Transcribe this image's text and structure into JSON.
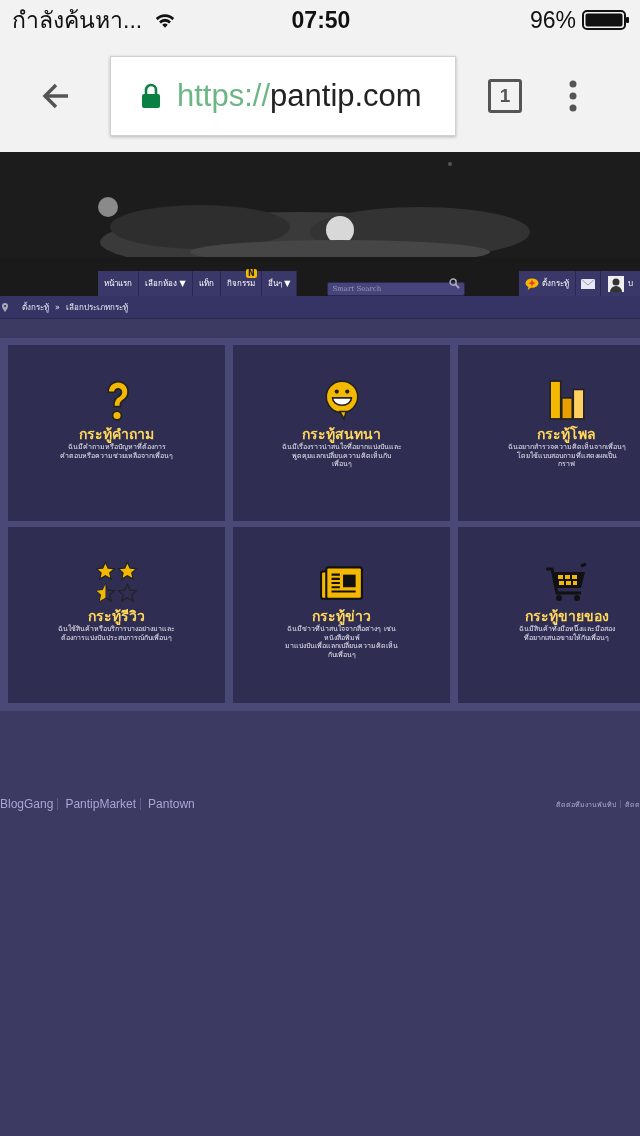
{
  "status_bar": {
    "carrier": "กำลังค้นหา...",
    "time": "07:50",
    "battery": "96%"
  },
  "browser": {
    "url_scheme": "https://",
    "url_host": "pantip.com",
    "tab_count": "1"
  },
  "nav": {
    "items": [
      {
        "label": "หน้าแรก"
      },
      {
        "label": "เลือกห้อง ▼"
      },
      {
        "label": "แท็ก"
      },
      {
        "label": "กิจกรรม",
        "badge": "N"
      },
      {
        "label": "อื่นๆ ▼"
      }
    ],
    "search": {
      "placeholder": "Smart Search"
    },
    "post_label": "ตั้งกระทู้",
    "user_label": "บ"
  },
  "breadcrumb": {
    "items": [
      "ตั้งกระทู้",
      "เลือกประเภทกระทู้"
    ],
    "separator": "»"
  },
  "cards": [
    {
      "kind": "question",
      "title": "กระทู้คำถาม",
      "lines": [
        "ฉันมีคำถามหรือปัญหาที่ต้องการ",
        "คำตอบหรือความช่วยเหลือจากเพื่อนๆ"
      ]
    },
    {
      "kind": "chat",
      "title": "กระทู้สนทนา",
      "lines": [
        "ฉันมีเรื่องราวน่าสนใจที่อยากแบ่งปันและ",
        "พูดคุยแลกเปลี่ยนความคิดเห็นกับ",
        "เพื่อนๆ"
      ]
    },
    {
      "kind": "poll",
      "title": "กระทู้โพล",
      "lines": [
        "ฉันอยากสำรวจความคิดเห็นจากเพื่อนๆ",
        "โดยใช้แบบสอบถามที่แสดงผลเป็น",
        "กราฟ"
      ]
    },
    {
      "kind": "review",
      "title": "กระทู้รีวิว",
      "lines": [
        "ฉันใช้สินค้าหรือบริการบางอย่างมาและ",
        "ต้องการแบ่งปันประสบการณ์กับเพื่อนๆ"
      ]
    },
    {
      "kind": "news",
      "title": "กระทู้ข่าว",
      "lines": [
        "ฉันมีข่าวที่น่าสนใจจากสื่อต่างๆ เช่น",
        "หนังสือพิมพ์",
        "มาแบ่งปันเพื่อแลกเปลี่ยนความคิดเห็น",
        "กับเพื่อนๆ"
      ]
    },
    {
      "kind": "shop",
      "title": "กระทู้ขายของ",
      "lines": [
        "ฉันมีสินค้าทั้งมือหนึ่งและมือสอง",
        "ที่อยากเสนอขายให้กับเพื่อนๆ"
      ]
    }
  ],
  "footer": {
    "left_links": [
      "BlogGang",
      "PantipMarket",
      "Pantown"
    ],
    "right_links": [
      "ติดต่อทีมงานพันทิป",
      "ติดต"
    ]
  }
}
